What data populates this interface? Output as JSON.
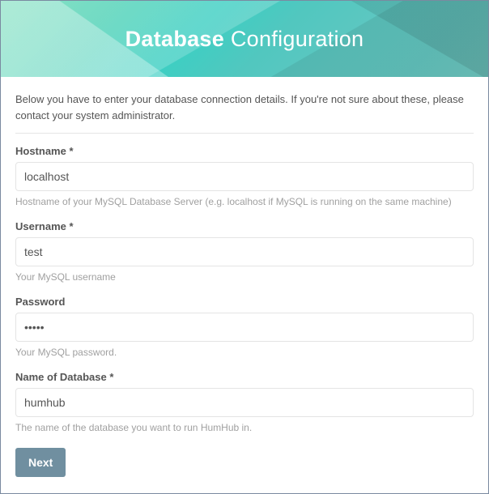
{
  "header": {
    "title_bold": "Database",
    "title_rest": "Configuration"
  },
  "intro_text": "Below you have to enter your database connection details. If you're not sure about these, please contact your system administrator.",
  "fields": {
    "hostname": {
      "label": "Hostname *",
      "value": "localhost",
      "help": "Hostname of your MySQL Database Server (e.g. localhost if MySQL is running on the same machine)"
    },
    "username": {
      "label": "Username *",
      "value": "test",
      "help": "Your MySQL username"
    },
    "password": {
      "label": "Password",
      "value": "•••••",
      "help": "Your MySQL password."
    },
    "dbname": {
      "label": "Name of Database *",
      "value": "humhub",
      "help": "The name of the database you want to run HumHub in."
    }
  },
  "buttons": {
    "next": "Next"
  }
}
